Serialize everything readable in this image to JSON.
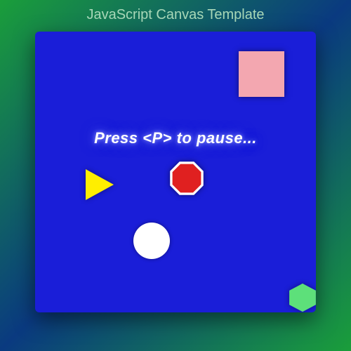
{
  "header": {
    "title": "JavaScript Canvas Template"
  },
  "canvas": {
    "message": "Press <P> to pause...",
    "background_color": "#1a1ed8",
    "shapes": {
      "square": {
        "name": "square",
        "color": "#f3a7b0"
      },
      "triangle": {
        "name": "triangle",
        "color": "#ffee00"
      },
      "octagon": {
        "name": "octagon",
        "fill": "#e02020",
        "stroke": "#ffffff"
      },
      "circle": {
        "name": "circle",
        "color": "#ffffff"
      },
      "hexagon": {
        "name": "hexagon",
        "color": "#5de07a"
      }
    }
  }
}
